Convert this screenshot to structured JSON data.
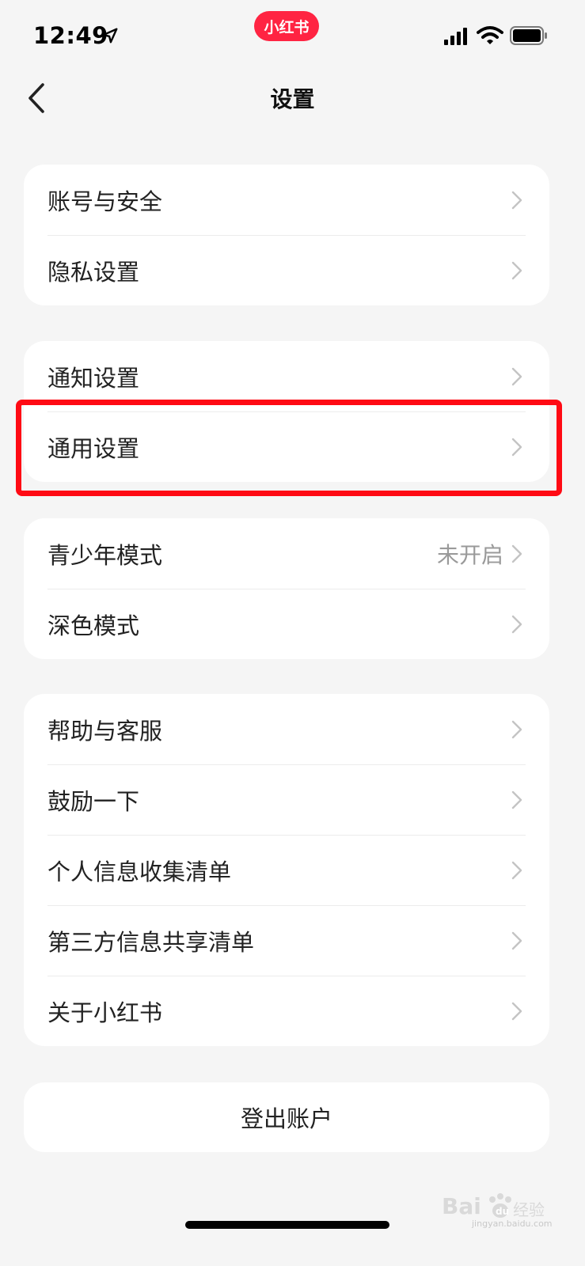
{
  "status_bar": {
    "time": "12:49",
    "app_badge": "小红书",
    "icons": [
      "location-arrow-icon",
      "signal-icon",
      "wifi-icon",
      "battery-icon"
    ]
  },
  "nav": {
    "back_icon": "chevron-left-icon",
    "title": "设置"
  },
  "groups": [
    {
      "items": [
        {
          "label": "账号与安全"
        },
        {
          "label": "隐私设置"
        }
      ]
    },
    {
      "items": [
        {
          "label": "通知设置"
        },
        {
          "label": "通用设置"
        }
      ]
    },
    {
      "items": [
        {
          "label": "青少年模式",
          "value": "未开启"
        },
        {
          "label": "深色模式"
        }
      ]
    },
    {
      "items": [
        {
          "label": "帮助与客服"
        },
        {
          "label": "鼓励一下"
        },
        {
          "label": "个人信息收集清单"
        },
        {
          "label": "第三方信息共享清单"
        },
        {
          "label": "关于小红书"
        }
      ]
    }
  ],
  "logout": {
    "label": "登出账户"
  },
  "annotation": {
    "highlight_color": "#ff0a14",
    "highlighted_item": "通用设置"
  },
  "watermark": {
    "text": "jingyan.baidu.com"
  },
  "colors": {
    "brand": "#ff2442",
    "background": "#f5f5f5",
    "card": "#ffffff",
    "secondary_text": "#9a9a9a"
  }
}
